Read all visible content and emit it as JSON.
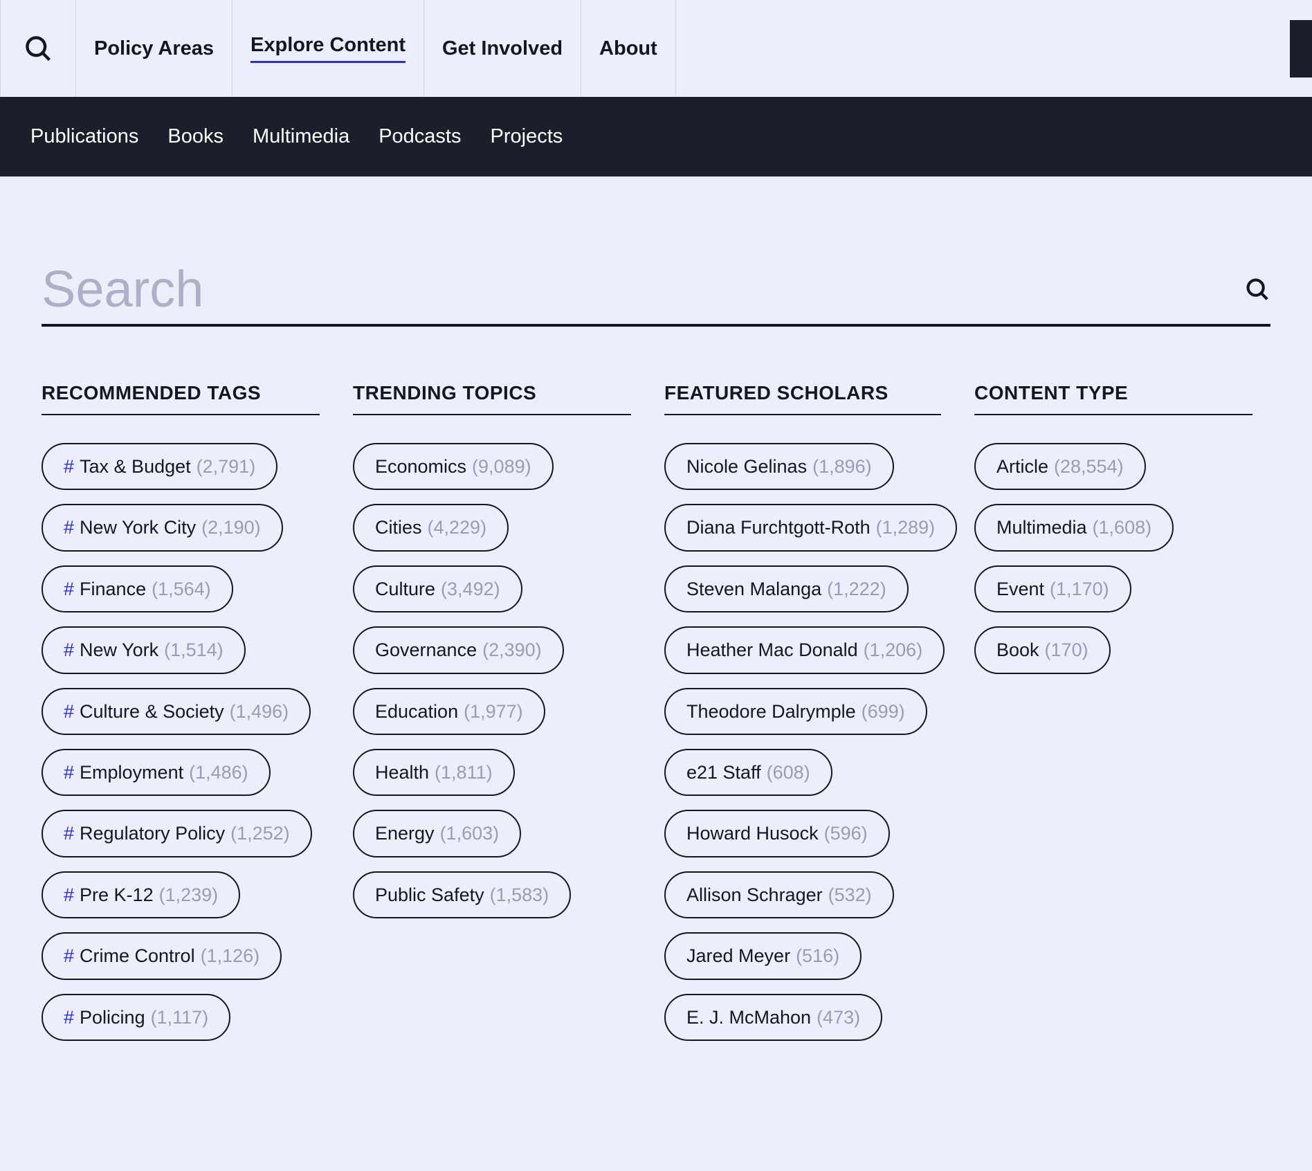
{
  "topnav": {
    "items": [
      {
        "label": "Policy Areas"
      },
      {
        "label": "Explore Content"
      },
      {
        "label": "Get Involved"
      },
      {
        "label": "About"
      }
    ]
  },
  "subnav": {
    "items": [
      {
        "label": "Publications"
      },
      {
        "label": "Books"
      },
      {
        "label": "Multimedia"
      },
      {
        "label": "Podcasts"
      },
      {
        "label": "Projects"
      }
    ]
  },
  "search": {
    "placeholder": "Search"
  },
  "columns": {
    "recommended": {
      "heading": "RECOMMENDED TAGS",
      "items": [
        {
          "label": "Tax & Budget",
          "count": "(2,791)"
        },
        {
          "label": "New York City",
          "count": "(2,190)"
        },
        {
          "label": "Finance",
          "count": "(1,564)"
        },
        {
          "label": "New York",
          "count": "(1,514)"
        },
        {
          "label": "Culture & Society",
          "count": "(1,496)"
        },
        {
          "label": "Employment",
          "count": "(1,486)"
        },
        {
          "label": "Regulatory Policy",
          "count": "(1,252)"
        },
        {
          "label": "Pre K-12",
          "count": "(1,239)"
        },
        {
          "label": "Crime Control",
          "count": "(1,126)"
        },
        {
          "label": "Policing",
          "count": "(1,117)"
        }
      ]
    },
    "trending": {
      "heading": "TRENDING TOPICS",
      "items": [
        {
          "label": "Economics",
          "count": "(9,089)"
        },
        {
          "label": "Cities",
          "count": "(4,229)"
        },
        {
          "label": "Culture",
          "count": "(3,492)"
        },
        {
          "label": "Governance",
          "count": "(2,390)"
        },
        {
          "label": "Education",
          "count": "(1,977)"
        },
        {
          "label": "Health",
          "count": "(1,811)"
        },
        {
          "label": "Energy",
          "count": "(1,603)"
        },
        {
          "label": "Public Safety",
          "count": "(1,583)"
        }
      ]
    },
    "scholars": {
      "heading": "FEATURED SCHOLARS",
      "items": [
        {
          "label": "Nicole Gelinas",
          "count": "(1,896)"
        },
        {
          "label": "Diana Furchtgott-Roth",
          "count": "(1,289)"
        },
        {
          "label": "Steven Malanga",
          "count": "(1,222)"
        },
        {
          "label": "Heather Mac Donald",
          "count": "(1,206)"
        },
        {
          "label": "Theodore Dalrymple",
          "count": "(699)"
        },
        {
          "label": "e21 Staff",
          "count": "(608)"
        },
        {
          "label": "Howard Husock",
          "count": "(596)"
        },
        {
          "label": "Allison Schrager",
          "count": "(532)"
        },
        {
          "label": "Jared Meyer",
          "count": "(516)"
        },
        {
          "label": "E. J. McMahon",
          "count": "(473)"
        }
      ]
    },
    "content_type": {
      "heading": "CONTENT TYPE",
      "items": [
        {
          "label": "Article",
          "count": "(28,554)"
        },
        {
          "label": "Multimedia",
          "count": "(1,608)"
        },
        {
          "label": "Event",
          "count": "(1,170)"
        },
        {
          "label": "Book",
          "count": "(170)"
        }
      ]
    }
  }
}
